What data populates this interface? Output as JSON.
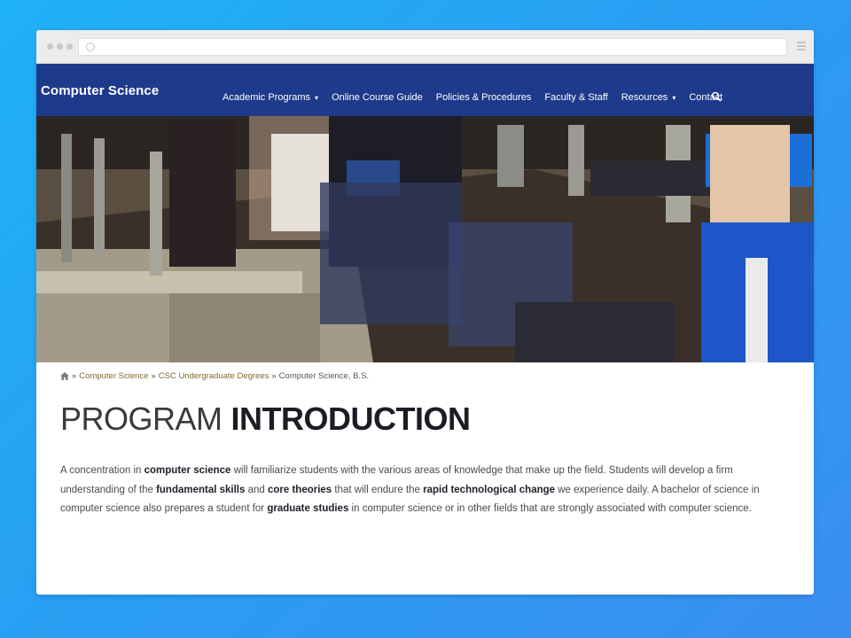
{
  "site": {
    "brand": "Computer Science",
    "nav": [
      {
        "label": "Academic Programs",
        "dropdown": true
      },
      {
        "label": "Online Course Guide",
        "dropdown": false
      },
      {
        "label": "Policies & Procedures",
        "dropdown": false
      },
      {
        "label": "Faculty & Staff",
        "dropdown": false
      },
      {
        "label": "Resources",
        "dropdown": true
      },
      {
        "label": "Contact",
        "dropdown": false
      }
    ],
    "caret": "▾"
  },
  "breadcrumb": {
    "separator": "»",
    "items": [
      "Computer Science",
      "CSC Undergraduate Degrees"
    ],
    "current": "Computer Science, B.S."
  },
  "page": {
    "title_light": "PROGRAM",
    "title_bold": "INTRODUCTION",
    "paragraph": [
      {
        "text": "A concentration in ",
        "bold": false
      },
      {
        "text": "computer science",
        "bold": true
      },
      {
        "text": " will familiarize students with the various areas of knowledge that make up the field. Students will develop a firm understanding of the ",
        "bold": false
      },
      {
        "text": "fundamental skills",
        "bold": true
      },
      {
        "text": " and ",
        "bold": false
      },
      {
        "text": "core theories",
        "bold": true
      },
      {
        "text": " that will endure the ",
        "bold": false
      },
      {
        "text": "rapid technological change",
        "bold": true
      },
      {
        "text": " we experience daily. A bachelor of science in computer science also prepares a student for ",
        "bold": false
      },
      {
        "text": "graduate studies",
        "bold": true
      },
      {
        "text": " in computer science or in other fields that are strongly associated with computer science.",
        "bold": false
      }
    ]
  },
  "colors": {
    "header_bg": "#1e3a8a",
    "page_bg": "#2a9df2",
    "breadcrumb_link": "#7b6b2e"
  },
  "icons": {
    "home": "home-icon",
    "search": "search-icon"
  }
}
